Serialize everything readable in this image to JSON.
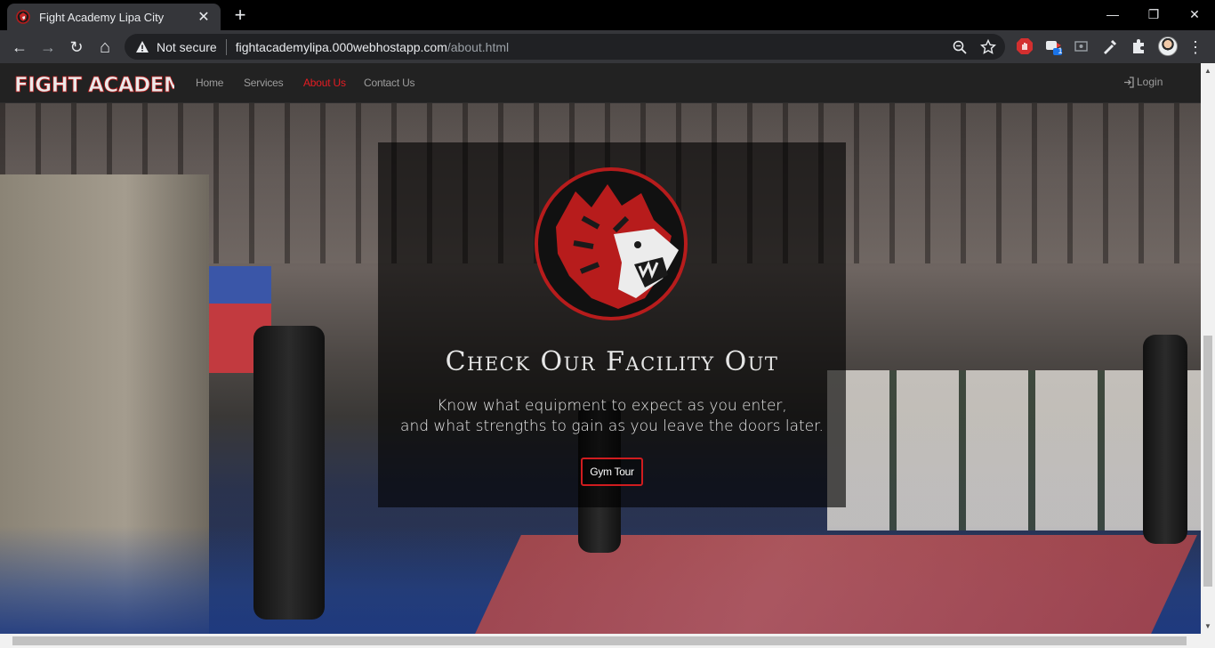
{
  "browser": {
    "tab": {
      "title": "Fight Academy Lipa City",
      "close": "✕"
    },
    "new_tab": "+",
    "window_controls": {
      "minimize": "—",
      "restore": "❐",
      "close": "✕"
    },
    "nav": {
      "back": "←",
      "forward": "→",
      "reload": "↻",
      "home": "⌂"
    },
    "omnibox": {
      "security_label": "Not secure",
      "url_host": "fightacademylipa.000webhostapp.com",
      "url_path": "/about.html"
    },
    "extension_badge": "1",
    "menu": "⋮"
  },
  "site": {
    "brand": "FIGHT ACADEMY",
    "nav": {
      "home": "Home",
      "services": "Services",
      "about": "About Us",
      "contact": "Contact Us",
      "login": "Login"
    },
    "hero": {
      "title": "Check Our Facility Out",
      "subtitle_line1": "Know what equipment to expect as you enter,",
      "subtitle_line2": "and what strengths to gain as you leave the doors later.",
      "button": "Gym Tour"
    },
    "colors": {
      "accent": "#e51c23",
      "nav_bg": "#222222"
    }
  }
}
